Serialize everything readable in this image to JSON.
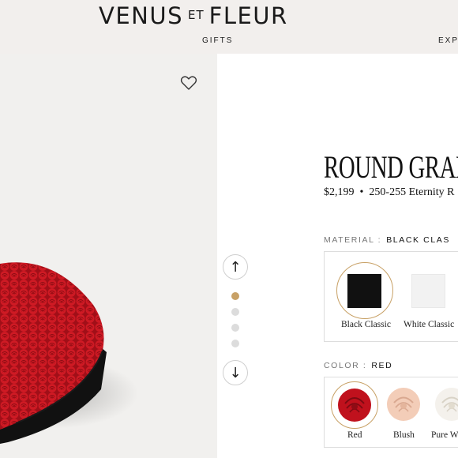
{
  "header": {
    "logo_left": "VENUS",
    "logo_et": "ET",
    "logo_right": "FLEUR",
    "nav_gifts": "GIFTS",
    "nav_explore": "EXP"
  },
  "gallery": {
    "wishlist_icon": "heart-outline-icon",
    "up_icon": "arrow-up-icon",
    "down_icon": "arrow-down-icon",
    "up_glyph": "↑",
    "down_glyph": "↓",
    "slide_count": 4,
    "active_slide": 1
  },
  "product": {
    "title": "ROUND GRAN",
    "price": "$2,199",
    "separator": "•",
    "description": "250-255 Eternity R"
  },
  "material": {
    "label": "MATERIAL :",
    "selected": "BLACK CLAS",
    "options": [
      {
        "name": "Black Classic",
        "color": "#111111"
      },
      {
        "name": "White Classic",
        "color": "#f2f2f2"
      }
    ]
  },
  "color": {
    "label": "COLOR :",
    "selected": "RED",
    "options": [
      {
        "name": "Red",
        "color": "#c0111d"
      },
      {
        "name": "Blush",
        "color": "#f3cdb8"
      },
      {
        "name": "Pure W",
        "color": "#f4f1ec"
      }
    ]
  },
  "colors": {
    "header_bg": "#f2efed",
    "gallery_bg": "#f1f0ee",
    "accent_gold": "#c8a166",
    "rose_red": "#c0111d",
    "box_black": "#111111"
  }
}
